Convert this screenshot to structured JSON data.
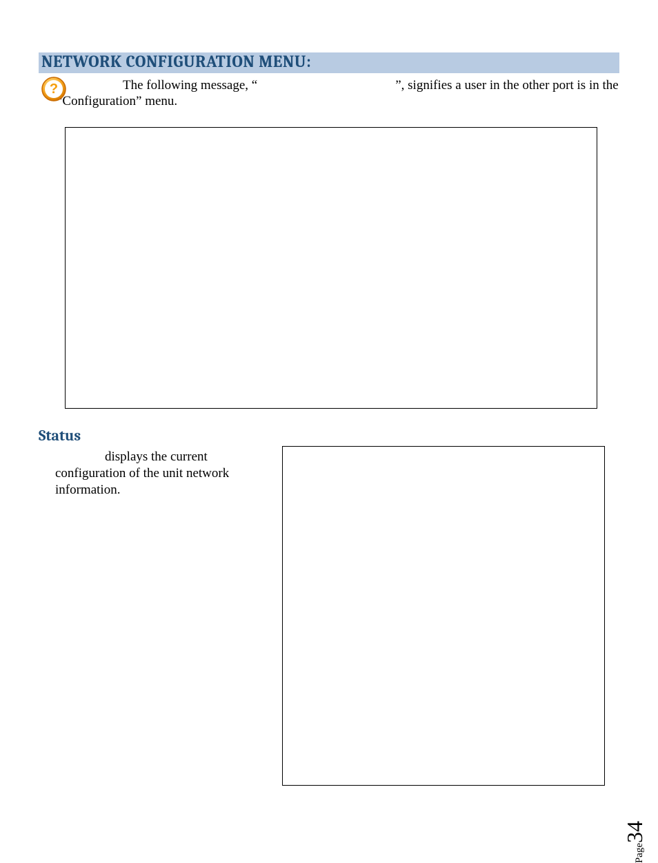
{
  "heading": "NETWORK CONFIGURATION MENU:",
  "intro": {
    "part1": "The following message, “",
    "part2": "”, signifies a user in the other port is in the “Configuration” menu."
  },
  "subheading": "Status",
  "status_text": "displays the current configuration of the unit network information.",
  "page": {
    "label": "Page",
    "number": "34"
  }
}
